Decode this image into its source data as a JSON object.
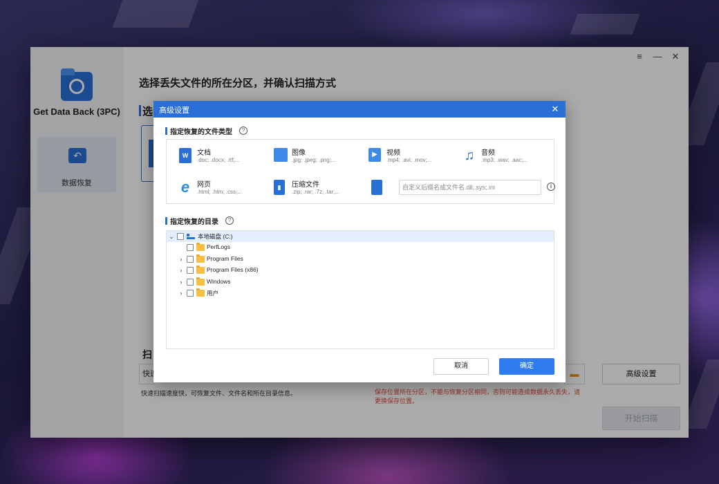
{
  "app": {
    "name": "Get Data Back (3PC)",
    "nav_item": "数据恢复",
    "page_title": "选择丢失文件的所在分区，并确认扫描方式",
    "section_partition_partial": "选",
    "section_scan_partial": "扫",
    "scan_mode_partial": "快速",
    "scan_hint": "快速扫描速度快，可恢复文件、文件名和所在目录信息。",
    "warning": "保存位置所在分区，不能与恢复分区相同，否则可能造成数据永久丢失，请更换保存位置。",
    "advanced_button": "高级设置",
    "start_button": "开始扫描",
    "window_controls": {
      "menu": "≡",
      "minimize": "—",
      "close": "✕"
    }
  },
  "dialog": {
    "title": "高级设置",
    "close_icon": "✕",
    "file_types_section": "指定恢复的文件类型",
    "dir_section": "指定恢复的目录",
    "help_glyph": "?",
    "info_glyph": "i",
    "file_types": [
      {
        "title": "文档",
        "exts": ".doc; .docx; .rtf;...",
        "icon": "word-doc-icon",
        "glyph": "W",
        "color": "#2a6fd6"
      },
      {
        "title": "图像",
        "exts": ".jpg; .jpeg; .png;...",
        "icon": "image-icon",
        "glyph": "",
        "color": "#3d8ae6"
      },
      {
        "title": "视频",
        "exts": ".mp4; .avi; .mov;...",
        "icon": "video-icon",
        "glyph": "▶",
        "color": "#3d8ae6"
      },
      {
        "title": "音频",
        "exts": ".mp3; .wav; .aac;...",
        "icon": "music-icon",
        "glyph": "♫",
        "color": "#ffffff"
      },
      {
        "title": "网页",
        "exts": ".html; .htm; .css;...",
        "icon": "ie-browser-icon",
        "glyph": "e",
        "color": "#ffffff"
      },
      {
        "title": "压缩文件",
        "exts": ".zip; .rar; .7z; .tar;...",
        "icon": "zip-file-icon",
        "glyph": "▮",
        "color": "#2a6fd6"
      }
    ],
    "custom_ext_placeholder": "自定义后缀名或文件名.dll;.sys;.ini",
    "tree": [
      {
        "label": "本地磁盘 (C:)",
        "arrow": "⌄"
      },
      {
        "label": "PerfLogs",
        "arrow": ""
      },
      {
        "label": "Program Files",
        "arrow": "›"
      },
      {
        "label": "Program Files (x86)",
        "arrow": "›"
      },
      {
        "label": "Windows",
        "arrow": "›"
      },
      {
        "label": "用户",
        "arrow": "›"
      }
    ],
    "cancel_button": "取消",
    "ok_button": "确定"
  },
  "colors": {
    "accent": "#2a6fd6",
    "warning": "#e24a3b",
    "folder": "#f5c043"
  }
}
